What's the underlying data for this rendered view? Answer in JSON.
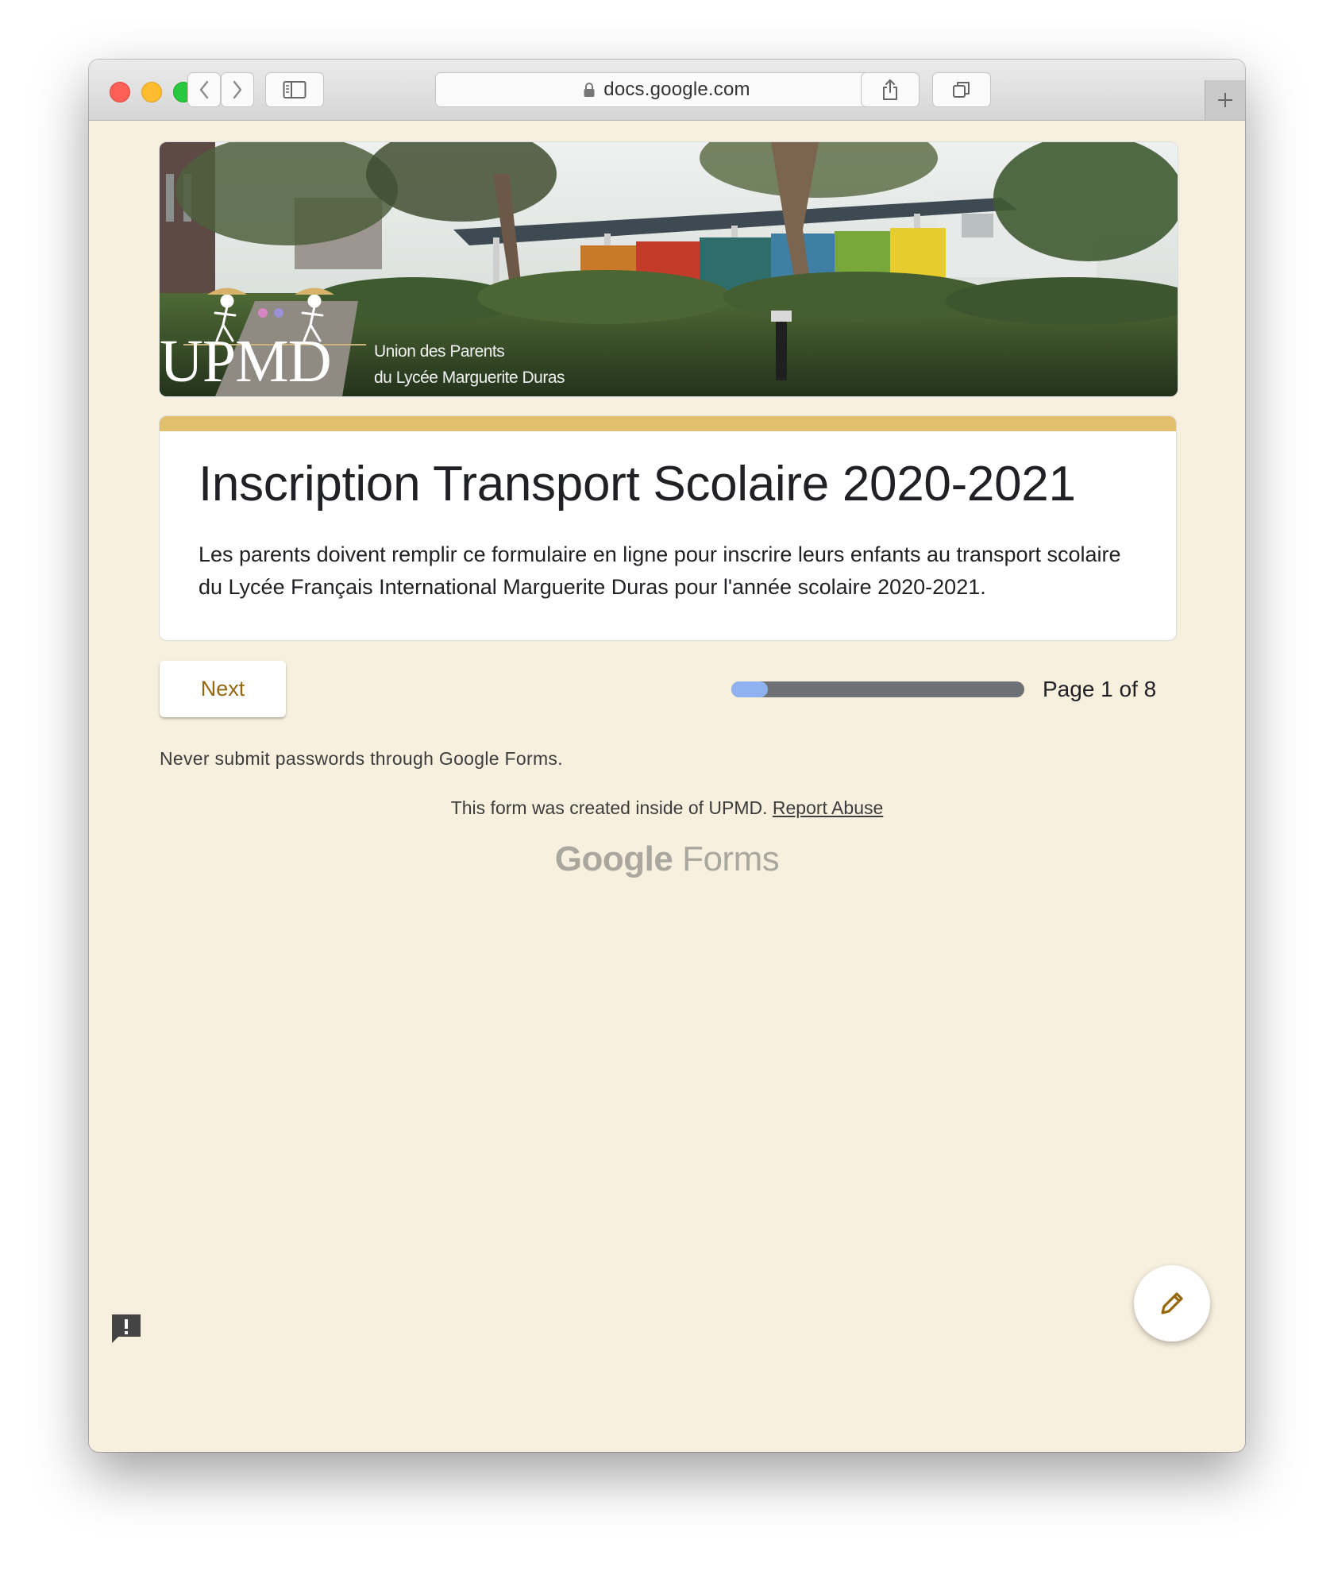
{
  "browser": {
    "url": "docs.google.com"
  },
  "banner": {
    "logo_text": "UPMD",
    "subtitle_line1": "Union des Parents",
    "subtitle_line2": "du Lycée Marguerite Duras"
  },
  "form": {
    "title": "Inscription Transport Scolaire 2020-2021",
    "description": "Les parents doivent remplir ce formulaire en ligne pour inscrire leurs enfants au transport scolaire du Lycée Français International Marguerite Duras pour l'année scolaire 2020-2021.",
    "accent_color": "#e2bf6c",
    "background_color": "#f8f0df"
  },
  "navigation": {
    "next_label": "Next",
    "page_text": "Page 1 of 8",
    "progress_fraction": 0.125
  },
  "footer": {
    "warning": "Never submit passwords through Google Forms.",
    "created_text": "This form was created inside of UPMD.",
    "report_link": "Report Abuse",
    "logo_google": "Google",
    "logo_forms": "Forms"
  },
  "icons": {
    "fab": "pencil-icon",
    "feedback": "feedback-icon"
  }
}
